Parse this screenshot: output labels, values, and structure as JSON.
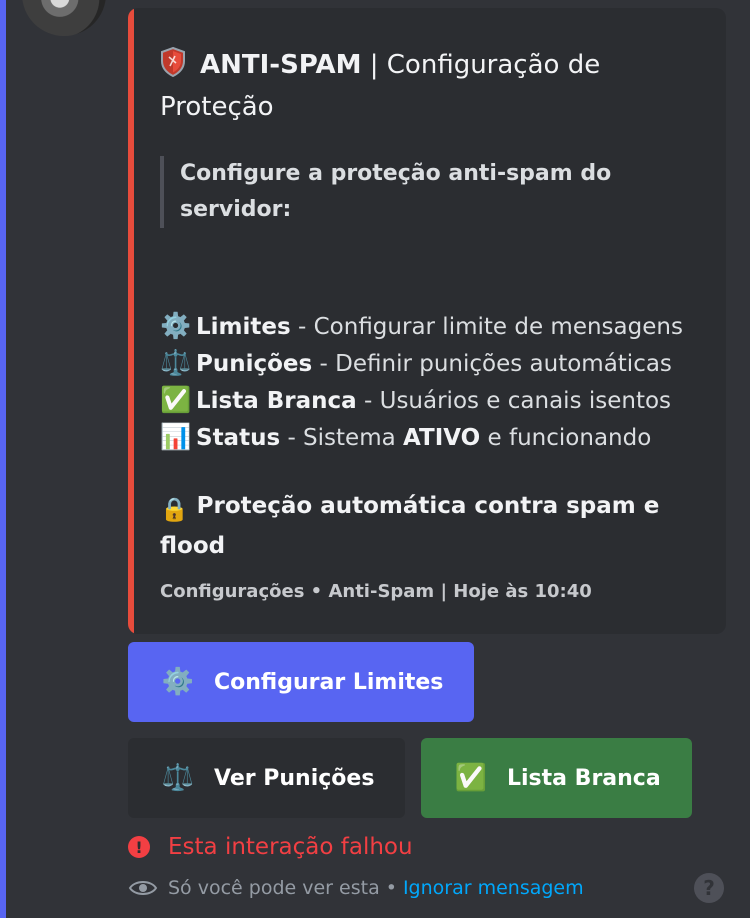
{
  "embed": {
    "title_bold": "ANTI-SPAM",
    "title_rest": " | Configuração de Proteção",
    "quote": "Configure a proteção anti-spam do servidor:",
    "items": [
      {
        "icon": "⚙️",
        "icon_name": "gear-icon",
        "label": "Limites",
        "desc": " - Configurar limite de mensagens"
      },
      {
        "icon": "⚖️",
        "icon_name": "scales-icon",
        "label": "Punições",
        "desc": " - Definir punições automáticas"
      },
      {
        "icon": "✅",
        "icon_name": "check-icon",
        "label": "Lista Branca",
        "desc": " - Usuários e canais isentos"
      },
      {
        "icon": "📊",
        "icon_name": "bar-chart-icon",
        "label": "Status",
        "desc_pre": " - Sistema ",
        "desc_strong": "ATIVO",
        "desc_post": " e funcionando"
      }
    ],
    "auto_icon": "🔒",
    "auto_text": "Proteção automática contra spam e flood",
    "footer": "Configurações • Anti-Spam | Hoje às 10:40",
    "accent_color": "#e74c3c"
  },
  "buttons": {
    "configure": {
      "icon": "⚙️",
      "label": "Configurar Limites"
    },
    "punishments": {
      "icon": "⚖️",
      "label": "Ver Punições"
    },
    "whitelist": {
      "icon": "✅",
      "label": "Lista Branca"
    }
  },
  "status": {
    "fail_text": "Esta interação falhou",
    "ephemeral_text": "Só você pode ver esta",
    "dismiss_link": "Ignorar mensagem"
  },
  "colors": {
    "primary": "#5865f2",
    "success": "#3a7d44",
    "danger": "#f23f43",
    "link": "#00a8fc"
  }
}
